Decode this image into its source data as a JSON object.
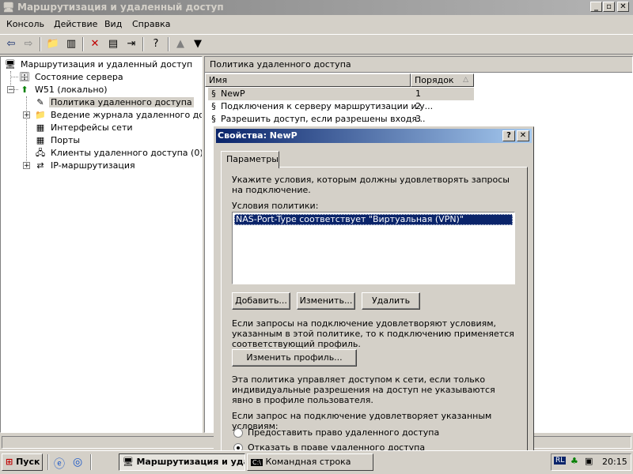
{
  "window": {
    "title": "Маршрутизация и удаленный доступ"
  },
  "menu": {
    "items": [
      {
        "label": "Консоль"
      },
      {
        "label": "Действие"
      },
      {
        "label": "Вид"
      },
      {
        "label": "Справка"
      }
    ]
  },
  "tree": {
    "root": "Маршрутизация и удаленный доступ",
    "server_status": "Состояние сервера",
    "server": "W51 (локально)",
    "children": [
      {
        "label": "Политика удаленного доступа"
      },
      {
        "label": "Ведение журнала удаленного доступа"
      },
      {
        "label": "Интерфейсы сети"
      },
      {
        "label": "Порты"
      },
      {
        "label": "Клиенты удаленного доступа (0)"
      },
      {
        "label": "IP-маршрутизация"
      }
    ]
  },
  "right": {
    "header": "Политика удаленного доступа",
    "columns": {
      "name": "Имя",
      "order": "Порядок"
    },
    "rows": [
      {
        "name": "NewP",
        "order": "1"
      },
      {
        "name": "Подключения к серверу маршрутизации и у...",
        "order": "2"
      },
      {
        "name": "Разрешить доступ, если разрешены входя...",
        "order": "3"
      }
    ]
  },
  "dialog": {
    "title": "Свойства: NewP",
    "tab": "Параметры",
    "intro": "Укажите условия, которым должны удовлетворять запросы на подключение.",
    "conditions_label": "Условия политики:",
    "conditions": [
      "NAS-Port-Type соответствует \"Виртуальная (VPN)\""
    ],
    "buttons": {
      "add": "Добавить...",
      "edit": "Изменить...",
      "remove": "Удалить"
    },
    "profile_text": "Если запросы на подключение удовлетворяют условиям, указанным в этой политике, то к подключению применяется соответствующий профиль.",
    "edit_profile": "Изменить профиль...",
    "policy_text": "Эта политика управляет доступом к сети, если только индивидуальные разрешения на доступ не указываются явно в профиле пользователя.",
    "match_text": "Если запрос на подключение удовлетворяет указанным условиям:",
    "radio_grant": "Предоставить право удаленного доступа",
    "radio_deny": "Отказать в праве удаленного доступа",
    "selected": "deny"
  },
  "taskbar": {
    "start": "Пуск",
    "tasks": [
      {
        "label": "Маршрутизация и уда..."
      },
      {
        "label": "Командная строка"
      }
    ],
    "lang": "RL",
    "clock": "20:15"
  }
}
